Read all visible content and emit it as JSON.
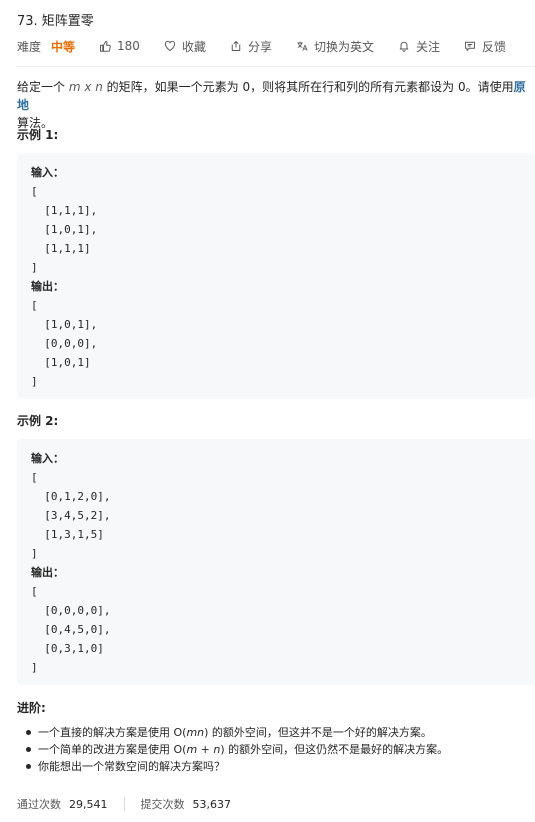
{
  "problem": {
    "title": "73. 矩阵置零",
    "difficulty_label": "难度",
    "difficulty": "中等",
    "likes": "180",
    "favorite_label": "收藏",
    "share_label": "分享",
    "translate_label": "切换为英文",
    "follow_label": "关注",
    "feedback_label": "反馈"
  },
  "description": {
    "part1": "给定一个 ",
    "dims": "m x n",
    "part2": " 的矩阵，如果一个元素为 0，则将其所在行和列的所有元素都设为 0。请使用",
    "link": "原地",
    "part3": "算法。"
  },
  "example1": {
    "heading": "示例 1:",
    "input_label": "输入：",
    "input_lines": [
      "[",
      "  [1,1,1],",
      "  [1,0,1],",
      "  [1,1,1]",
      "]"
    ],
    "output_label": "输出：",
    "output_lines": [
      "[",
      "  [1,0,1],",
      "  [0,0,0],",
      "  [1,0,1]",
      "]"
    ]
  },
  "example2": {
    "heading": "示例 2:",
    "input_label": "输入：",
    "input_lines": [
      "[",
      "  [0,1,2,0],",
      "  [3,4,5,2],",
      "  [1,3,1,5]",
      "]"
    ],
    "output_label": "输出：",
    "output_lines": [
      "[",
      "  [0,0,0,0],",
      "  [0,4,5,0],",
      "  [0,3,1,0]",
      "]"
    ]
  },
  "advanced": {
    "heading": "进阶:",
    "item1_a": "一个直接的解决方案是使用  O(",
    "item1_it": "mn",
    "item1_b": ") 的额外空间，但这并不是一个好的解决方案。",
    "item2_a": "一个简单的改进方案是使用 O(",
    "item2_it": "m",
    "item2_mid": " + ",
    "item2_it2": "n",
    "item2_b": ") 的额外空间，但这仍然不是最好的解决方案。",
    "item3": "你能想出一个常数空间的解决方案吗？"
  },
  "stats": {
    "accepted_label": "通过次数",
    "accepted": "29,541",
    "submitted_label": "提交次数",
    "submitted": "53,637"
  },
  "colors": {
    "difficulty_medium": "#ef6c00",
    "link": "#2f6fa8",
    "code_bg": "#f7f8fa"
  }
}
